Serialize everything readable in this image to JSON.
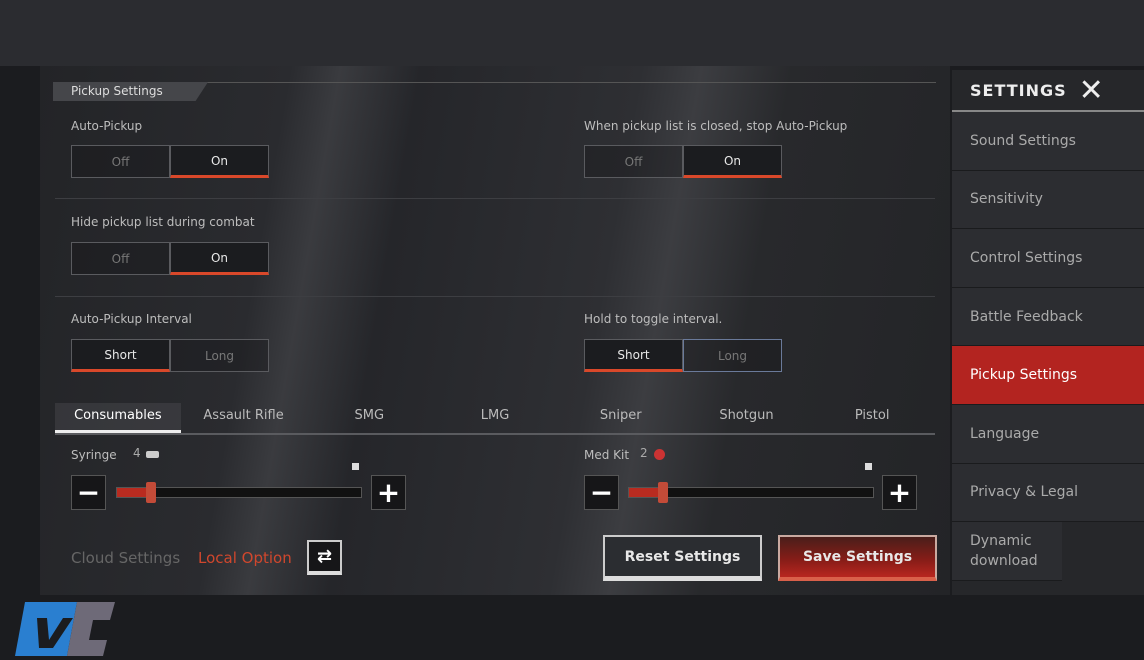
{
  "section_title": "Pickup Settings",
  "settings": [
    {
      "label": "Auto-Pickup",
      "options": [
        "Off",
        "On"
      ],
      "selected": "On"
    },
    {
      "label": "When pickup list is closed, stop Auto-Pickup",
      "options": [
        "Off",
        "On"
      ],
      "selected": "On"
    },
    {
      "label": "Hide pickup list during combat",
      "options": [
        "Off",
        "On"
      ],
      "selected": "On"
    },
    {
      "label": "Auto-Pickup Interval",
      "options": [
        "Short",
        "Long"
      ],
      "selected": "Short"
    },
    {
      "label": "Hold to toggle interval.",
      "options": [
        "Short",
        "Long"
      ],
      "selected": "Short"
    }
  ],
  "tabs": [
    "Consumables",
    "Assault Rifle",
    "SMG",
    "LMG",
    "Sniper",
    "Shotgun",
    "Pistol"
  ],
  "active_tab": "Consumables",
  "sliders": [
    {
      "label": "Syringe",
      "value": "4",
      "fraction": 0.14
    },
    {
      "label": "Med Kit",
      "value": "2",
      "fraction": 0.14
    }
  ],
  "footer": {
    "cloud": "Cloud Settings",
    "local": "Local Option",
    "reset": "Reset Settings",
    "save": "Save Settings"
  },
  "sidebar": {
    "title": "SETTINGS",
    "items": [
      "Sound Settings",
      "Sensitivity",
      "Control Settings",
      "Battle Feedback",
      "Pickup Settings",
      "Language",
      "Privacy & Legal",
      "Dynamic download"
    ],
    "active": "Pickup Settings"
  },
  "colors": {
    "accent": "#b32420",
    "logo_blue": "#2a7fd0"
  },
  "logo": "VC"
}
